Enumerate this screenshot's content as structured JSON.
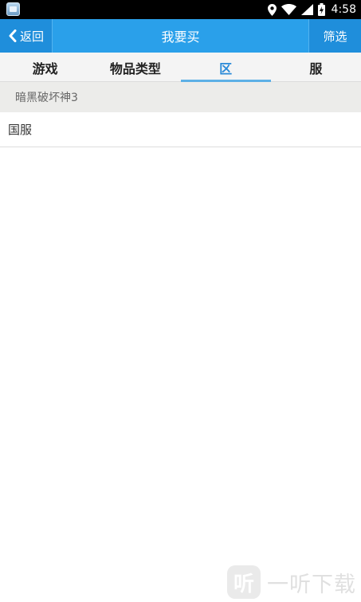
{
  "status_bar": {
    "time": "4:58",
    "icons": [
      "app-icon",
      "location-icon",
      "wifi-icon",
      "signal-icon",
      "battery-icon"
    ]
  },
  "header": {
    "back_label": "返回",
    "title": "我要买",
    "filter_label": "筛选"
  },
  "tabs": [
    {
      "label": "游戏",
      "active": false
    },
    {
      "label": "物品类型",
      "active": false
    },
    {
      "label": "区",
      "active": true
    },
    {
      "label": "服",
      "active": false
    }
  ],
  "section": {
    "header": "暗黑破坏神3",
    "items": [
      "国服"
    ]
  },
  "watermark": {
    "badge": "听",
    "text": "一听下载"
  },
  "colors": {
    "accent": "#2aa0ea",
    "button_bg": "#1f8edb",
    "tab_active": "#2a8ad8",
    "tab_indicator": "#5db0e6"
  }
}
